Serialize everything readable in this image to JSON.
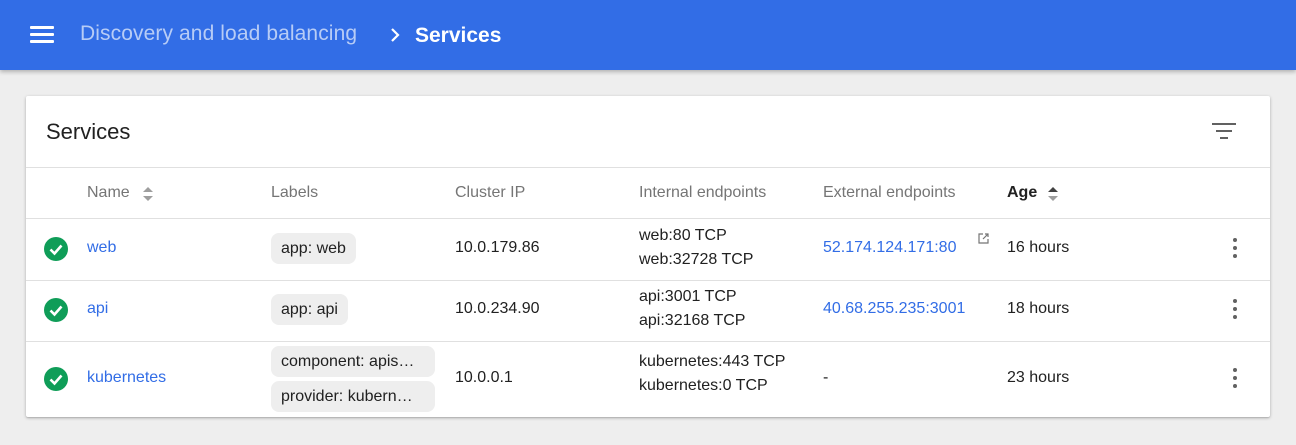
{
  "header": {
    "breadcrumb_parent": "Discovery and load balancing",
    "breadcrumb_current": "Services"
  },
  "card": {
    "title": "Services",
    "columns": {
      "name": "Name",
      "labels": "Labels",
      "cluster_ip": "Cluster IP",
      "internal_endpoints": "Internal endpoints",
      "external_endpoints": "External endpoints",
      "age": "Age"
    },
    "rows": [
      {
        "name": "web",
        "labels": [
          "app: web"
        ],
        "cluster_ip": "10.0.179.86",
        "internal_endpoints": [
          "web:80 TCP",
          "web:32728 TCP"
        ],
        "external_endpoint": "52.174.124.171:80",
        "age": "16 hours"
      },
      {
        "name": "api",
        "labels": [
          "app: api"
        ],
        "cluster_ip": "10.0.234.90",
        "internal_endpoints": [
          "api:3001 TCP",
          "api:32168 TCP"
        ],
        "external_endpoint": "40.68.255.235:3001",
        "age": "18 hours"
      },
      {
        "name": "kubernetes",
        "labels": [
          "component: apis…",
          "provider: kubern…"
        ],
        "cluster_ip": "10.0.0.1",
        "internal_endpoints": [
          "kubernetes:443 TCP",
          "kubernetes:0 TCP"
        ],
        "external_endpoint": "-",
        "age": "23 hours"
      }
    ]
  },
  "colors": {
    "brand": "#326de6",
    "status_ok": "#0f9d58",
    "link": "#326de6"
  },
  "icons": {
    "menu": "menu-icon",
    "chevron": "chevron-right-icon",
    "filter": "filter-icon",
    "sort": "sort-icon",
    "status": "check-circle-icon",
    "external": "open-in-new-icon",
    "more": "more-vert-icon"
  }
}
